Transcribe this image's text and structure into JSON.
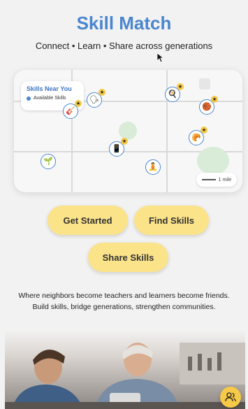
{
  "app": {
    "title": "Skill Match",
    "tagline": "Connect • Learn • Share across generations"
  },
  "map": {
    "legend_title": "Skills Near You",
    "legend_item": "Available Skills",
    "scale_label": "1 mile",
    "pins": [
      {
        "id": "guitar",
        "glyph": "🎸",
        "icon": "guitar-icon",
        "starred": true
      },
      {
        "id": "speaking",
        "glyph": "🗣",
        "icon": "speaking-icon",
        "starred": true
      },
      {
        "id": "cooking",
        "glyph": "🍳",
        "icon": "cooking-icon",
        "starred": true
      },
      {
        "id": "basketball",
        "glyph": "🏀",
        "icon": "basketball-icon",
        "starred": true
      },
      {
        "id": "baking",
        "glyph": "🥐",
        "icon": "baking-icon",
        "starred": true
      },
      {
        "id": "phone",
        "glyph": "📱",
        "icon": "phone-icon",
        "starred": true
      },
      {
        "id": "gardening",
        "glyph": "🌱",
        "icon": "plant-icon",
        "starred": false
      },
      {
        "id": "yoga",
        "glyph": "🧘",
        "icon": "meditation-icon",
        "starred": false
      }
    ],
    "star_glyph": "★"
  },
  "actions": {
    "get_started": "Get Started",
    "find_skills": "Find Skills",
    "share_skills": "Share Skills"
  },
  "description": {
    "line1": "Where neighbors become teachers and learners become friends.",
    "line2": "Build skills, bridge generations, strengthen communities."
  },
  "colors": {
    "brand_blue": "#4a86cf",
    "button_yellow": "#fbe38a",
    "star_yellow": "#f7c948"
  }
}
